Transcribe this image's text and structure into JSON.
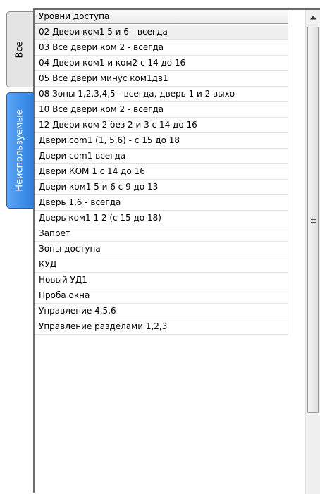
{
  "tabs": {
    "all_label": "Все",
    "unused_label": "Неиспользуемые"
  },
  "list": {
    "header": "Уровни доступа",
    "items": [
      "02 Двери ком1 5 и 6 - всегда",
      "03 Все двери ком 2 - всегда",
      "04 Двери ком1 и ком2 с 14 до 16",
      "05 Все двери минус ком1дв1",
      "08 Зоны 1,2,3,4,5 - всегда, дверь 1 и 2 выхо",
      "10 Все двери ком 2 - всегда",
      "12 Двери ком 2 без 2 и 3 с 14 до 16",
      "Двери com1 (1, 5,6) - с 15 до 18",
      "Двери com1 всегда",
      "Двери КОМ 1 с 14 до 16",
      "Двери ком1 5 и 6 с 9 до 13",
      "Дверь 1,6 - всегда",
      "Дверь ком1 1  2  (с 15 до 18)",
      "Запрет",
      "Зоны доступа",
      "КУД",
      "Новый УД1",
      "Проба окна",
      "Управление 4,5,6",
      "Управление разделами 1,2,3"
    ]
  },
  "scrollbar": {
    "up_icon": "arrow-up-icon",
    "thumb_icon": "grip-icon"
  }
}
